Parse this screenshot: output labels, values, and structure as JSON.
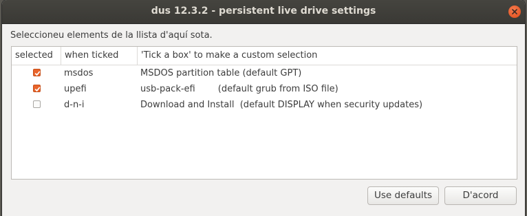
{
  "window": {
    "title": "dus 12.3.2 - persistent live drive settings"
  },
  "prompt": "Seleccioneu elements de la llista d'aquí sota.",
  "table": {
    "columns": [
      "selected",
      "when ticked",
      "'Tick a box' to make a custom selection"
    ],
    "rows": [
      {
        "selected": true,
        "name": "msdos",
        "description": "MSDOS partition table (default GPT)"
      },
      {
        "selected": true,
        "name": "upefi",
        "description": "usb-pack-efi        (default grub from ISO file)"
      },
      {
        "selected": false,
        "name": "d-n-i",
        "description": "Download and Install  (default DISPLAY when security updates)"
      }
    ]
  },
  "buttons": {
    "defaults": "Use defaults",
    "ok": "D'acord"
  },
  "colors": {
    "titlebar": "#3c3b37",
    "close": "#e95420",
    "checkbox_checked": "#e9642b"
  }
}
